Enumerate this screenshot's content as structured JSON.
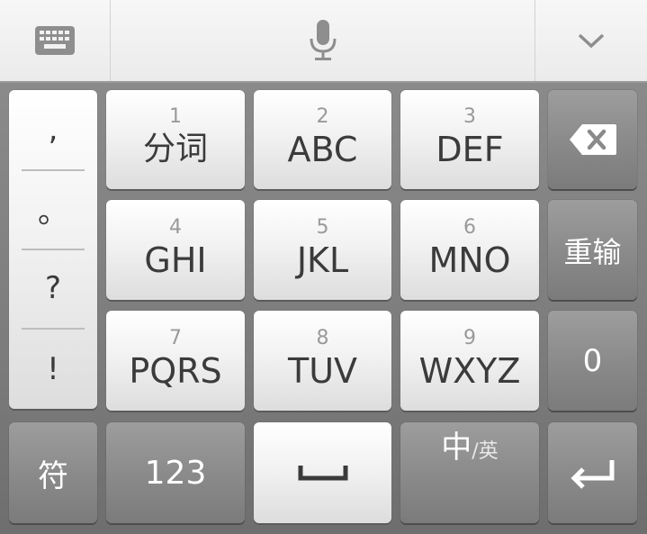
{
  "toolbar": {
    "keyboard_icon": "keyboard-icon",
    "mic_icon": "microphone-icon",
    "collapse_icon": "chevron-down-icon"
  },
  "punctuation": [
    ",",
    "。",
    "?",
    "!"
  ],
  "keys": {
    "k1": {
      "num": "1",
      "label": "分词"
    },
    "k2": {
      "num": "2",
      "label": "ABC"
    },
    "k3": {
      "num": "3",
      "label": "DEF"
    },
    "k4": {
      "num": "4",
      "label": "GHI"
    },
    "k5": {
      "num": "5",
      "label": "JKL"
    },
    "k6": {
      "num": "6",
      "label": "MNO"
    },
    "k7": {
      "num": "7",
      "label": "PQRS"
    },
    "k8": {
      "num": "8",
      "label": "TUV"
    },
    "k9": {
      "num": "9",
      "label": "WXYZ"
    }
  },
  "side": {
    "backspace_icon": "backspace-icon",
    "reenter": "重输",
    "zero": "0",
    "enter_icon": "enter-icon"
  },
  "bottom": {
    "symbols": "符",
    "numbers": "123",
    "space_icon": "space-icon",
    "lang_main": "中",
    "lang_sep": "/",
    "lang_alt": "英"
  }
}
